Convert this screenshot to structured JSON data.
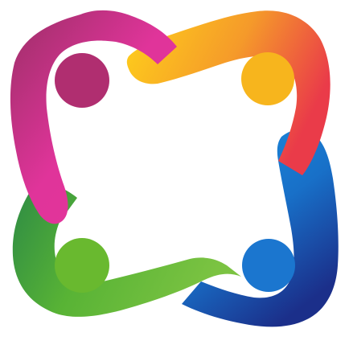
{
  "logo": {
    "name": "community-people-circle-logo",
    "background_color": "#ffffff",
    "figures": [
      {
        "id": "top-left",
        "head_color": "#b02e70",
        "arm_gradient": [
          "#9c2f67",
          "#e0349a",
          "#e5359c"
        ]
      },
      {
        "id": "top-right",
        "head_color": "#f7b51d",
        "arm_gradient": [
          "#ffd21a",
          "#f59a2a",
          "#ea3b49"
        ]
      },
      {
        "id": "bottom-right",
        "head_color": "#1b76cf",
        "arm_gradient": [
          "#1e90e0",
          "#1870c8",
          "#1b2f8a"
        ]
      },
      {
        "id": "bottom-left",
        "head_color": "#69b92f",
        "arm_gradient": [
          "#2c8a45",
          "#58b335",
          "#7bc342"
        ]
      }
    ]
  }
}
